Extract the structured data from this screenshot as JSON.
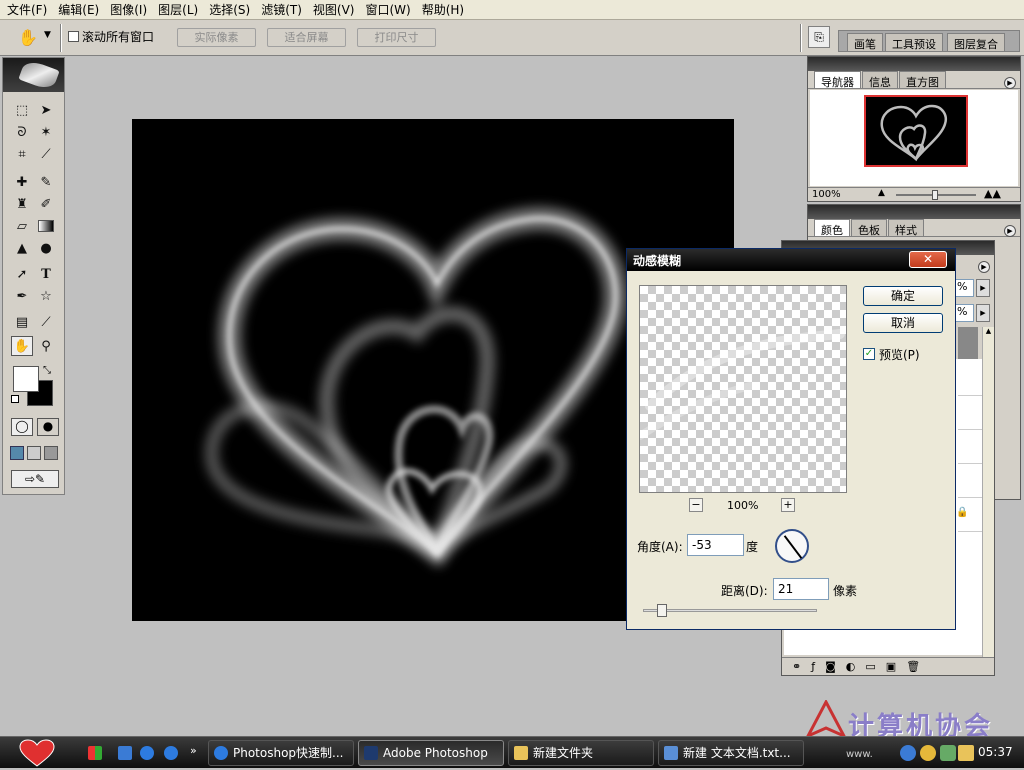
{
  "menu": [
    "文件(F)",
    "编辑(E)",
    "图像(I)",
    "图层(L)",
    "选择(S)",
    "滤镜(T)",
    "视图(V)",
    "窗口(W)",
    "帮助(H)"
  ],
  "options": {
    "scroll_all": "滚动所有窗口",
    "actual_pixels": "实际像素",
    "fit_screen": "适合屏幕",
    "print_size": "打印尺寸"
  },
  "palette_well": [
    "画笔",
    "工具预设",
    "图层复合"
  ],
  "navigator": {
    "tabs": [
      "导航器",
      "信息",
      "直方图"
    ],
    "zoom": "100%"
  },
  "color_panel": {
    "tabs": [
      "颜色",
      "色板",
      "样式"
    ]
  },
  "dialog": {
    "title": "动感模糊",
    "ok": "确定",
    "cancel": "取消",
    "preview_label": "预览(P)",
    "preview_checked": true,
    "zoom": "100%",
    "zoom_minus": "−",
    "zoom_plus": "+",
    "angle_label": "角度(A):",
    "angle_value": "-53",
    "angle_unit": "度",
    "distance_label": "距离(D):",
    "distance_value": "21",
    "distance_unit": "像素"
  },
  "layer_panel": {
    "percent1": "%",
    "percent2": "%"
  },
  "taskbar": {
    "tasks": [
      "Photoshop快速制...",
      "Adobe Photoshop",
      "新建文件夹",
      "新建 文本文档.txt..."
    ],
    "clock": "05:37"
  },
  "watermark": {
    "text": "计算机协会",
    "url": "www."
  },
  "colors": {
    "canvas": "#000000",
    "dialog_bg": "#ece9d8",
    "workspace": "#c0c0c0"
  }
}
